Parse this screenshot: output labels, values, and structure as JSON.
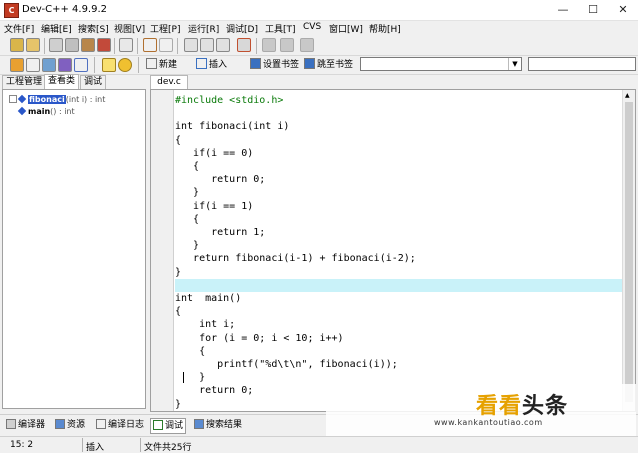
{
  "window": {
    "title": "Dev-C++ 4.9.9.2",
    "minimize": "—",
    "maximize": "☐",
    "close": "✕"
  },
  "menu": [
    "文件[F]",
    "编辑[E]",
    "搜索[S]",
    "视图[V]",
    "工程[P]",
    "运行[R]",
    "调试[D]",
    "工具[T]",
    "CVS",
    "窗口[W]",
    "帮助[H]"
  ],
  "toolbar2": {
    "new_label": "新建",
    "insert_label": "插入",
    "set_bookmark_label": "设置书签",
    "goto_bookmark_label": "跳至书签"
  },
  "left_tabs": [
    "工程管理",
    "查看类",
    "调试"
  ],
  "class_tree": [
    {
      "name": "fibonaci",
      "sig": "(int i) : int"
    },
    {
      "name": "main",
      "sig": "() : int"
    }
  ],
  "editor": {
    "tab": "dev.c",
    "lines": [
      "#include <stdio.h>",
      "",
      "int fibonaci(int i)",
      "{",
      "   if(i == 0)",
      "   {",
      "      return 0;",
      "   }",
      "   if(i == 1)",
      "   {",
      "      return 1;",
      "   }",
      "   return fibonaci(i-1) + fibonaci(i-2);",
      "}",
      "",
      "int  main()",
      "{",
      "    int i;",
      "    for (i = 0; i < 10; i++)",
      "    {",
      "       printf(\"%d\\t\\n\", fibonaci(i));",
      "    }",
      "    return 0;",
      "}"
    ],
    "highlight_line": 15
  },
  "bottom_tabs": [
    "编译器",
    "资源",
    "编译日志",
    "调试",
    "搜索结果"
  ],
  "status": {
    "position": "15: 2",
    "mode": "插入",
    "lines": "文件共25行"
  },
  "watermark": {
    "title_a": "看看",
    "title_b": "头条",
    "url": "www.kankantoutiao.com"
  },
  "colors": {
    "current_line": "#c9f2f9",
    "selection": "#2a57c9",
    "watermark_accent": "#e6a100"
  }
}
